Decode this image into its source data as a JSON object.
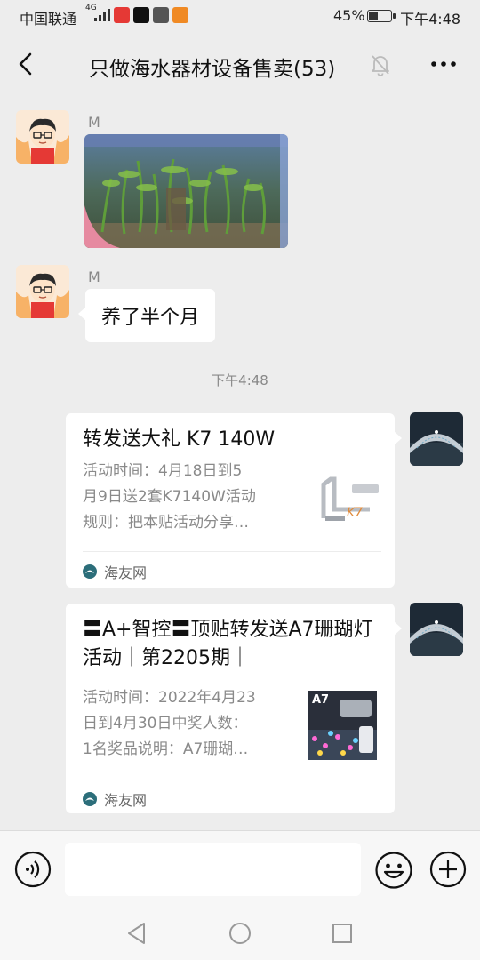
{
  "status_bar": {
    "carrier": "中国联通",
    "network": "4G",
    "battery_percent": "45%",
    "battery_level": 0.45,
    "time": "下午4:48"
  },
  "header": {
    "title": "只做海水器材设备售卖(53)"
  },
  "messages": [
    {
      "type": "image",
      "sender": "M"
    },
    {
      "type": "text",
      "sender": "M",
      "text": "养了半个月"
    },
    {
      "type": "time",
      "text": "下午4:48"
    },
    {
      "type": "link-card",
      "title": "转发送大礼 K7 140W",
      "desc": "活动时间：4月18日到5\n月9日送2套K7140W活动\n规则：把本贴活动分享…",
      "thumb_label": "K7",
      "source": "海友网"
    },
    {
      "type": "link-card",
      "title": "〓A+智控〓顶贴转发送A7珊瑚灯活动｜第2205期｜",
      "desc": "活动时间：2022年4月23\n日到4月30日中奖人数：\n1名奖品说明：A7珊瑚…",
      "thumb_label": "A7",
      "source": "海友网"
    }
  ],
  "input": {
    "placeholder": ""
  },
  "colors": {
    "background": "#ededed",
    "bubble": "#ffffff",
    "meta_text": "#888888",
    "source_icon": "#2c6e7a"
  }
}
